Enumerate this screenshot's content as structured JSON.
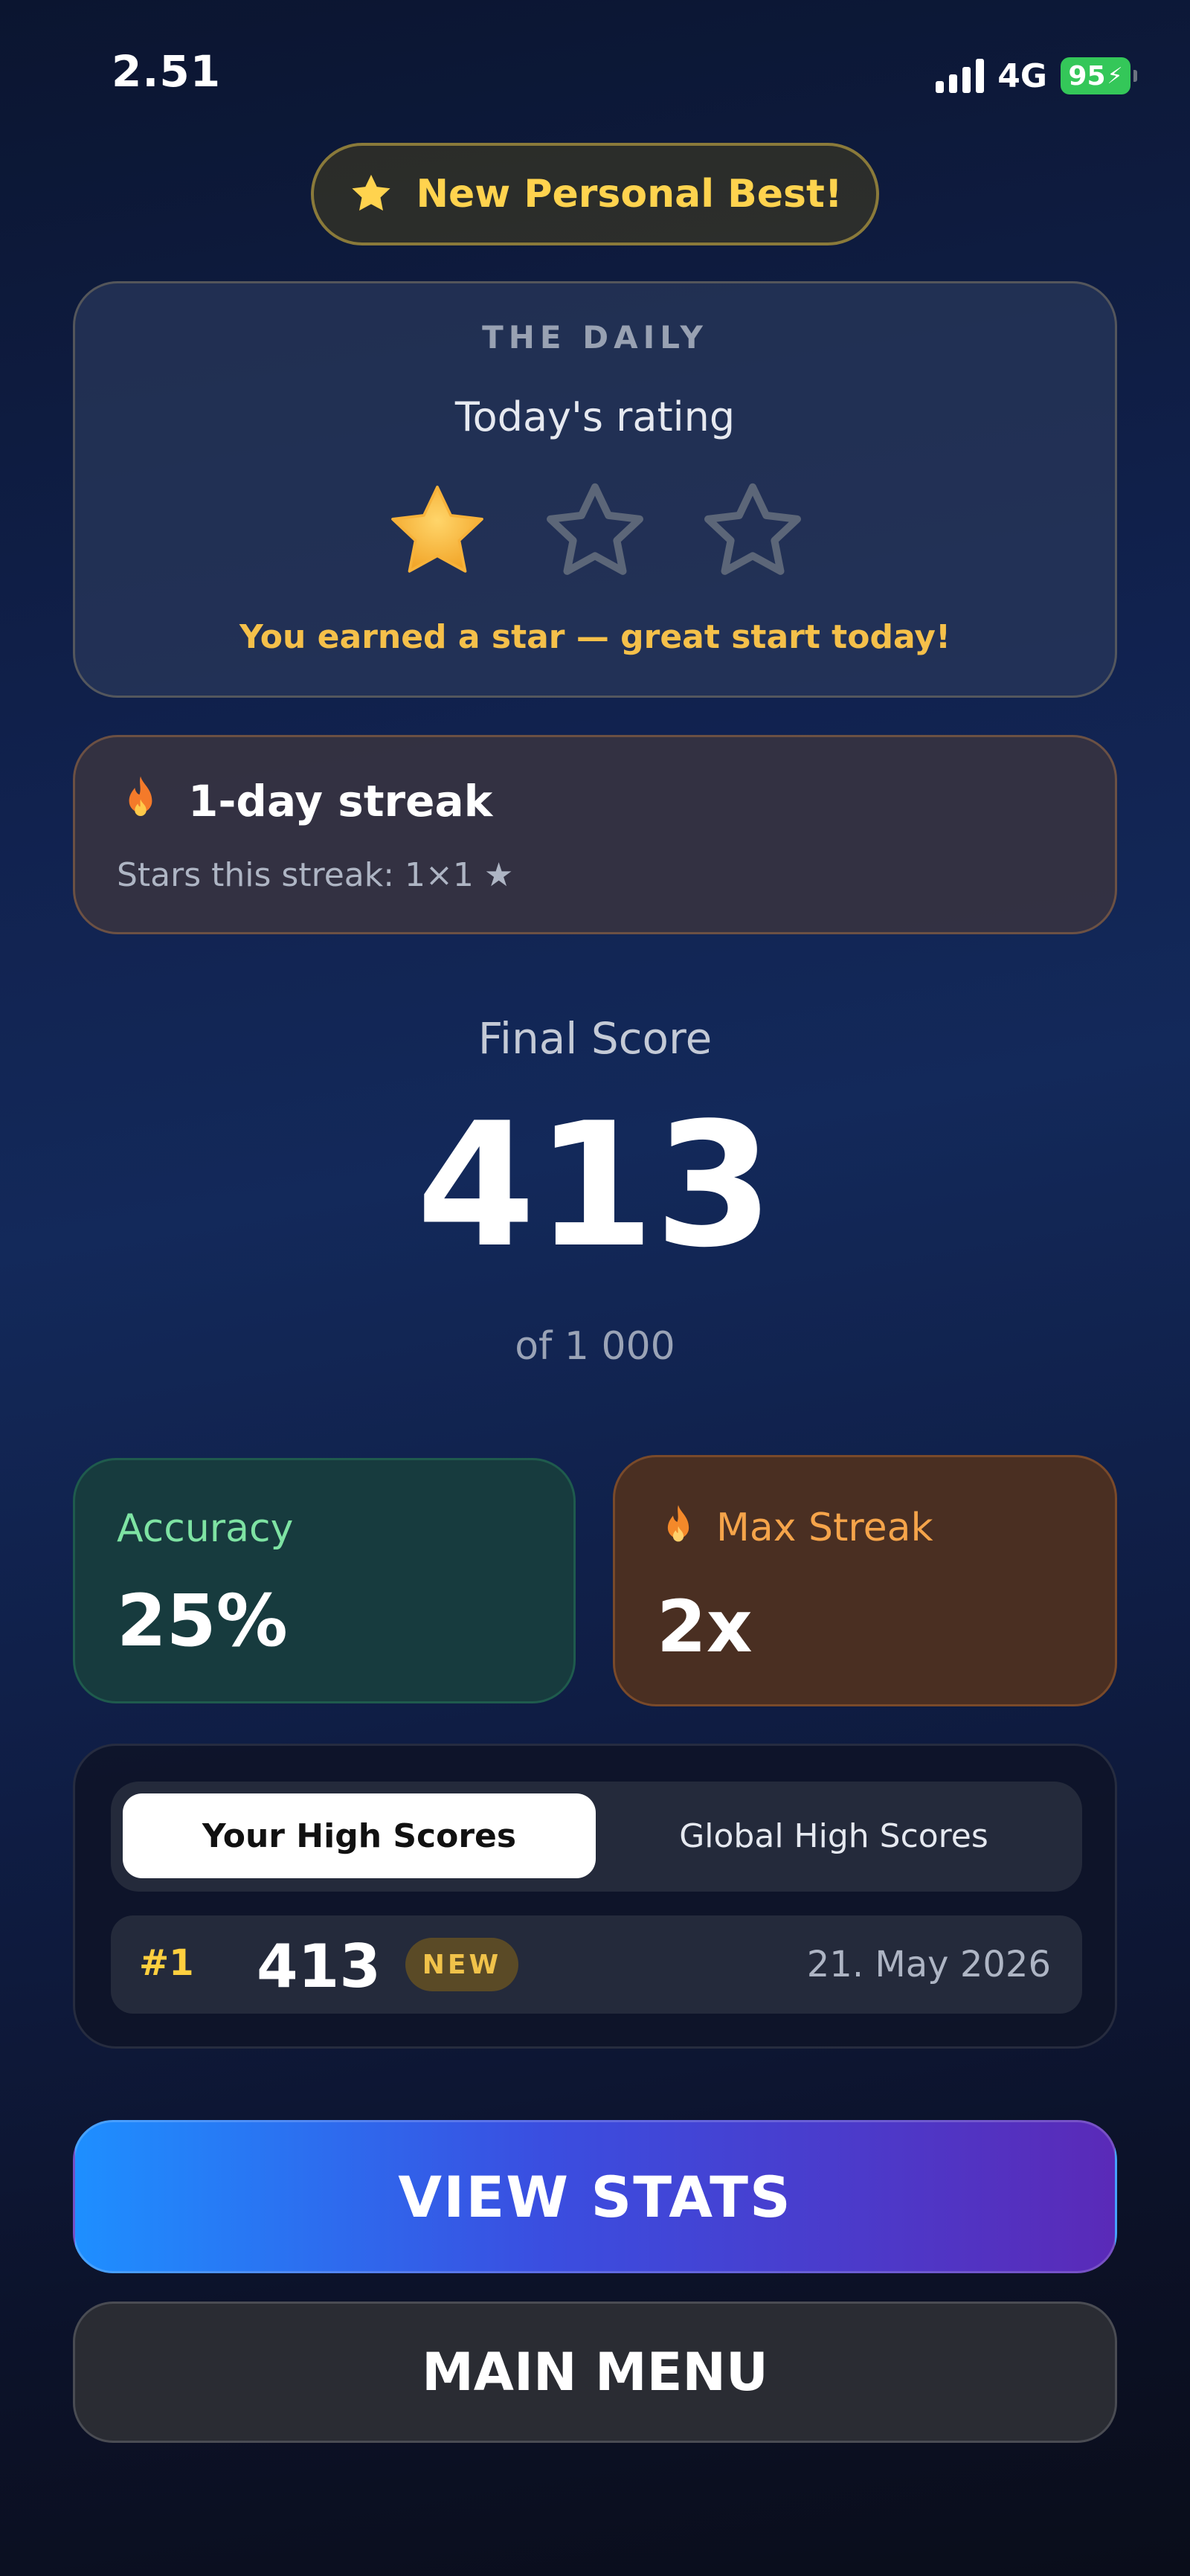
{
  "status_bar": {
    "time": "2.51",
    "network": "4G",
    "battery": "95",
    "signal_icon": "signal-bars-icon",
    "battery_icon": "battery-charging-icon"
  },
  "badge": {
    "label": "New Personal Best!",
    "icon": "star-icon",
    "color": "#ffd34e"
  },
  "daily": {
    "overline": "THE DAILY",
    "title": "Today's rating",
    "stars_earned": 1,
    "stars_total": 3,
    "message": "You earned a star — great start today!"
  },
  "streak": {
    "title": "1-day streak",
    "subtitle": "Stars this streak: 1×1",
    "icon": "flame-icon"
  },
  "final": {
    "label": "Final Score",
    "score": "413",
    "of": "of 1 000"
  },
  "stats": {
    "accuracy_label": "Accuracy",
    "accuracy_value": "25%",
    "max_streak_label": "Max Streak",
    "max_streak_value": "2x"
  },
  "high_scores": {
    "tabs": [
      "Your High Scores",
      "Global High Scores"
    ],
    "active_tab": "Your High Scores",
    "rows": [
      {
        "rank": "#1",
        "score": "413",
        "badge": "NEW",
        "date": "21. May 2026"
      }
    ]
  },
  "buttons": {
    "view_stats": "VIEW STATS",
    "main_menu": "MAIN MENU"
  },
  "colors": {
    "accent_gold": "#f5c04a",
    "accuracy_green": "#7ee3a3",
    "streak_orange": "#f5a44a",
    "button_gradient_start": "#1e8fff",
    "button_gradient_end": "#5a2ab8"
  }
}
